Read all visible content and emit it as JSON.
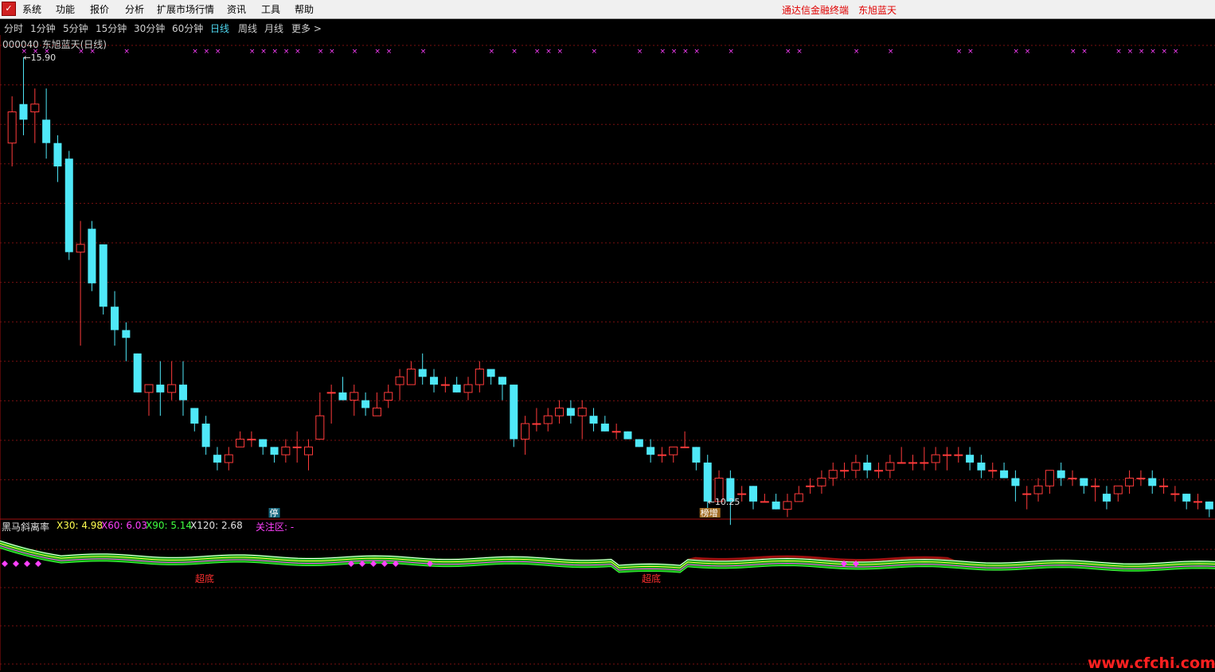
{
  "menu": {
    "items": [
      "系统",
      "功能",
      "报价",
      "分析",
      "扩展市场行情",
      "资讯",
      "工具",
      "帮助"
    ],
    "brand": [
      "通达信金融终端",
      "东旭蓝天"
    ]
  },
  "periods": {
    "items": [
      "分时",
      "1分钟",
      "5分钟",
      "15分钟",
      "30分钟",
      "60分钟",
      "日线",
      "周线",
      "月线",
      "更多 >"
    ],
    "active": "日线"
  },
  "stock": {
    "label": "000040 东旭蓝天(日线)",
    "high_label": "15.90",
    "low_label": "10.25",
    "tags": {
      "stop": "停",
      "bang": "榜增"
    }
  },
  "indicator": {
    "name": "黑马斜离率",
    "x30": "X30: 4.98",
    "x60": "X60: 6.03",
    "x90": "X90: 5.14",
    "x120": "X120: 2.68",
    "focus": "关注区: -",
    "signals": [
      "超底",
      "超底"
    ]
  },
  "colors": {
    "up": "#ff3b3b",
    "down": "#4fe8f8",
    "grid": "#7a1010",
    "x30": "#ffff50",
    "x60": "#ff40ff",
    "x90": "#40ff40",
    "x120": "#ffffff",
    "marker": "#ff40ff"
  },
  "chart_data": {
    "type": "candlestick",
    "ohlc_note": "approximate values read from the picture",
    "candles": [
      [
        14.8,
        15.2,
        15.4,
        14.5
      ],
      [
        15.3,
        15.1,
        15.9,
        14.9
      ],
      [
        15.2,
        15.3,
        15.5,
        14.8
      ],
      [
        15.1,
        14.8,
        15.5,
        14.6
      ],
      [
        14.8,
        14.5,
        14.9,
        14.3
      ],
      [
        14.6,
        13.4,
        14.7,
        13.3
      ],
      [
        13.4,
        13.5,
        13.8,
        12.2
      ],
      [
        13.7,
        13.0,
        13.8,
        12.9
      ],
      [
        13.5,
        12.7,
        13.5,
        12.6
      ],
      [
        12.7,
        12.4,
        12.9,
        12.2
      ],
      [
        12.4,
        12.3,
        12.5,
        12.0
      ],
      [
        12.1,
        11.6,
        12.1,
        11.6
      ],
      [
        11.6,
        11.7,
        11.7,
        11.3
      ],
      [
        11.7,
        11.6,
        12.0,
        11.3
      ],
      [
        11.6,
        11.7,
        12.0,
        11.5
      ],
      [
        11.7,
        11.5,
        12.0,
        11.3
      ],
      [
        11.4,
        11.2,
        11.4,
        11.1
      ],
      [
        11.2,
        10.9,
        11.3,
        10.8
      ],
      [
        10.8,
        10.7,
        10.9,
        10.6
      ],
      [
        10.7,
        10.8,
        10.9,
        10.6
      ],
      [
        10.9,
        11.0,
        11.1,
        10.9
      ],
      [
        11.0,
        11.0,
        11.1,
        10.9
      ],
      [
        11.0,
        10.9,
        11.0,
        10.8
      ],
      [
        10.9,
        10.8,
        10.9,
        10.7
      ],
      [
        10.8,
        10.9,
        11.0,
        10.7
      ],
      [
        10.9,
        10.9,
        11.1,
        10.7
      ],
      [
        10.8,
        10.9,
        11.0,
        10.6
      ],
      [
        11.0,
        11.3,
        11.6,
        11.0
      ],
      [
        11.6,
        11.6,
        11.7,
        11.2
      ],
      [
        11.6,
        11.5,
        11.8,
        11.5
      ],
      [
        11.5,
        11.6,
        11.7,
        11.3
      ],
      [
        11.5,
        11.4,
        11.6,
        11.3
      ],
      [
        11.3,
        11.4,
        11.6,
        11.3
      ],
      [
        11.5,
        11.6,
        11.7,
        11.4
      ],
      [
        11.7,
        11.8,
        11.9,
        11.5
      ],
      [
        11.7,
        11.9,
        12.0,
        11.7
      ],
      [
        11.9,
        11.8,
        12.1,
        11.7
      ],
      [
        11.8,
        11.7,
        11.9,
        11.6
      ],
      [
        11.7,
        11.7,
        11.8,
        11.6
      ],
      [
        11.7,
        11.6,
        11.8,
        11.6
      ],
      [
        11.6,
        11.7,
        11.8,
        11.5
      ],
      [
        11.7,
        11.9,
        12.0,
        11.6
      ],
      [
        11.9,
        11.8,
        11.9,
        11.7
      ],
      [
        11.8,
        11.7,
        11.8,
        11.5
      ],
      [
        11.7,
        11.0,
        11.7,
        10.9
      ],
      [
        11.0,
        11.2,
        11.3,
        10.8
      ],
      [
        11.2,
        11.2,
        11.4,
        11.1
      ],
      [
        11.2,
        11.3,
        11.4,
        11.1
      ],
      [
        11.3,
        11.4,
        11.5,
        11.2
      ],
      [
        11.4,
        11.3,
        11.5,
        11.2
      ],
      [
        11.3,
        11.4,
        11.5,
        11.0
      ],
      [
        11.3,
        11.2,
        11.4,
        11.1
      ],
      [
        11.2,
        11.1,
        11.3,
        11.1
      ],
      [
        11.1,
        11.1,
        11.2,
        11.0
      ],
      [
        11.1,
        11.0,
        11.1,
        11.0
      ],
      [
        11.0,
        10.9,
        11.0,
        10.9
      ],
      [
        10.9,
        10.8,
        11.0,
        10.7
      ],
      [
        10.8,
        10.8,
        10.9,
        10.7
      ],
      [
        10.8,
        10.9,
        10.9,
        10.7
      ],
      [
        10.9,
        10.9,
        11.1,
        10.9
      ],
      [
        10.9,
        10.7,
        10.9,
        10.6
      ],
      [
        10.7,
        10.2,
        10.8,
        10.1
      ],
      [
        10.2,
        10.5,
        10.6,
        10.2
      ],
      [
        10.5,
        10.2,
        10.6,
        9.9
      ],
      [
        10.3,
        10.3,
        10.4,
        10.2
      ],
      [
        10.4,
        10.2,
        10.4,
        10.1
      ],
      [
        10.2,
        10.2,
        10.3,
        10.2
      ],
      [
        10.2,
        10.1,
        10.3,
        10.1
      ],
      [
        10.1,
        10.2,
        10.3,
        10.0
      ],
      [
        10.2,
        10.3,
        10.4,
        10.2
      ],
      [
        10.4,
        10.4,
        10.5,
        10.3
      ],
      [
        10.4,
        10.5,
        10.6,
        10.3
      ],
      [
        10.5,
        10.6,
        10.7,
        10.4
      ],
      [
        10.6,
        10.6,
        10.7,
        10.5
      ],
      [
        10.6,
        10.7,
        10.8,
        10.5
      ],
      [
        10.7,
        10.6,
        10.8,
        10.5
      ],
      [
        10.6,
        10.6,
        10.7,
        10.5
      ],
      [
        10.6,
        10.7,
        10.8,
        10.5
      ],
      [
        10.7,
        10.7,
        10.9,
        10.7
      ],
      [
        10.7,
        10.7,
        10.8,
        10.6
      ],
      [
        10.7,
        10.7,
        10.9,
        10.6
      ],
      [
        10.7,
        10.8,
        10.9,
        10.6
      ],
      [
        10.8,
        10.8,
        10.9,
        10.6
      ],
      [
        10.8,
        10.8,
        10.9,
        10.7
      ],
      [
        10.8,
        10.7,
        10.9,
        10.6
      ],
      [
        10.7,
        10.6,
        10.8,
        10.5
      ],
      [
        10.6,
        10.6,
        10.7,
        10.5
      ],
      [
        10.6,
        10.5,
        10.7,
        10.5
      ],
      [
        10.5,
        10.4,
        10.6,
        10.2
      ],
      [
        10.3,
        10.3,
        10.4,
        10.1
      ],
      [
        10.3,
        10.4,
        10.5,
        10.2
      ],
      [
        10.4,
        10.6,
        10.6,
        10.3
      ],
      [
        10.6,
        10.5,
        10.7,
        10.4
      ],
      [
        10.5,
        10.5,
        10.6,
        10.4
      ],
      [
        10.5,
        10.4,
        10.5,
        10.3
      ],
      [
        10.4,
        10.4,
        10.5,
        10.2
      ],
      [
        10.3,
        10.2,
        10.4,
        10.1
      ],
      [
        10.3,
        10.4,
        10.4,
        10.2
      ],
      [
        10.4,
        10.5,
        10.6,
        10.3
      ],
      [
        10.5,
        10.5,
        10.6,
        10.4
      ],
      [
        10.5,
        10.4,
        10.6,
        10.3
      ],
      [
        10.4,
        10.4,
        10.5,
        10.3
      ],
      [
        10.3,
        10.3,
        10.4,
        10.2
      ],
      [
        10.3,
        10.2,
        10.3,
        10.1
      ],
      [
        10.2,
        10.2,
        10.3,
        10.1
      ],
      [
        10.2,
        10.1,
        10.2,
        10.0
      ]
    ],
    "markers": "top row of small magenta crosses above candles",
    "high": 15.9,
    "low": 10.25
  }
}
